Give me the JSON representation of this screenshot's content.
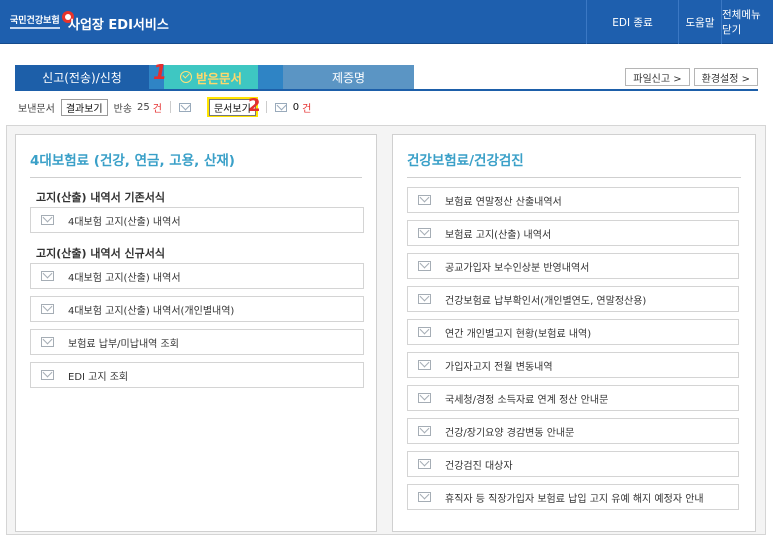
{
  "header": {
    "logo_text": "국민건강보험",
    "app_title": "사업장 EDI서비스",
    "menu": [
      "EDI 종료",
      "도움말",
      "전체메뉴 닫기"
    ]
  },
  "tabs": [
    {
      "label": "신고(전송)/신청"
    },
    {
      "label": "받은문서"
    },
    {
      "label": "제증명"
    }
  ],
  "annotations": {
    "step1": "1",
    "step2": "2"
  },
  "right_buttons": [
    "파일신고 >",
    "환경설정 >"
  ],
  "filter": {
    "sent_label": "보낸문서",
    "result_button": "결과보기",
    "return_label": "반송",
    "return_count": "25",
    "count_unit": "건",
    "doc_button": "문서보기",
    "print_count": "0",
    "print_unit": "건"
  },
  "left_panel": {
    "title": "4대보험료 (건강, 연금, 고용, 산재)",
    "groups": [
      {
        "title": "고지(산출) 내역서 기존서식",
        "items": [
          "4대보험 고지(산출) 내역서"
        ]
      },
      {
        "title": "고지(산출) 내역서 신규서식",
        "items": [
          "4대보험 고지(산출) 내역서",
          "4대보험 고지(산출) 내역서(개인별내역)",
          "보험료 납부/미납내역 조회",
          "EDI 고지 조회"
        ]
      }
    ]
  },
  "right_panel": {
    "title": "건강보험료/건강검진",
    "items": [
      "보험료 연말정산 산출내역서",
      "보험료 고지(산출) 내역서",
      "공교가입자 보수인상분 반영내역서",
      "건강보험료 납부확인서(개인별연도, 연말정산용)",
      "연간 개인별고지 현황(보험료 내역)",
      "가입자고지 전월 변동내역",
      "국세청/경정 소득자료 연계 정산 안내문",
      "건강/장기요양 경감변동 안내문",
      "건강검진 대상자",
      "휴직자 등 직장가입자 보험료 납입 고지 유예 해지 예정자 안내"
    ]
  },
  "colors": {
    "header_bg": "#1e5fae",
    "accent": "#3aa0c8",
    "highlight": "#ffe500",
    "count_red": "#e52e2e"
  }
}
